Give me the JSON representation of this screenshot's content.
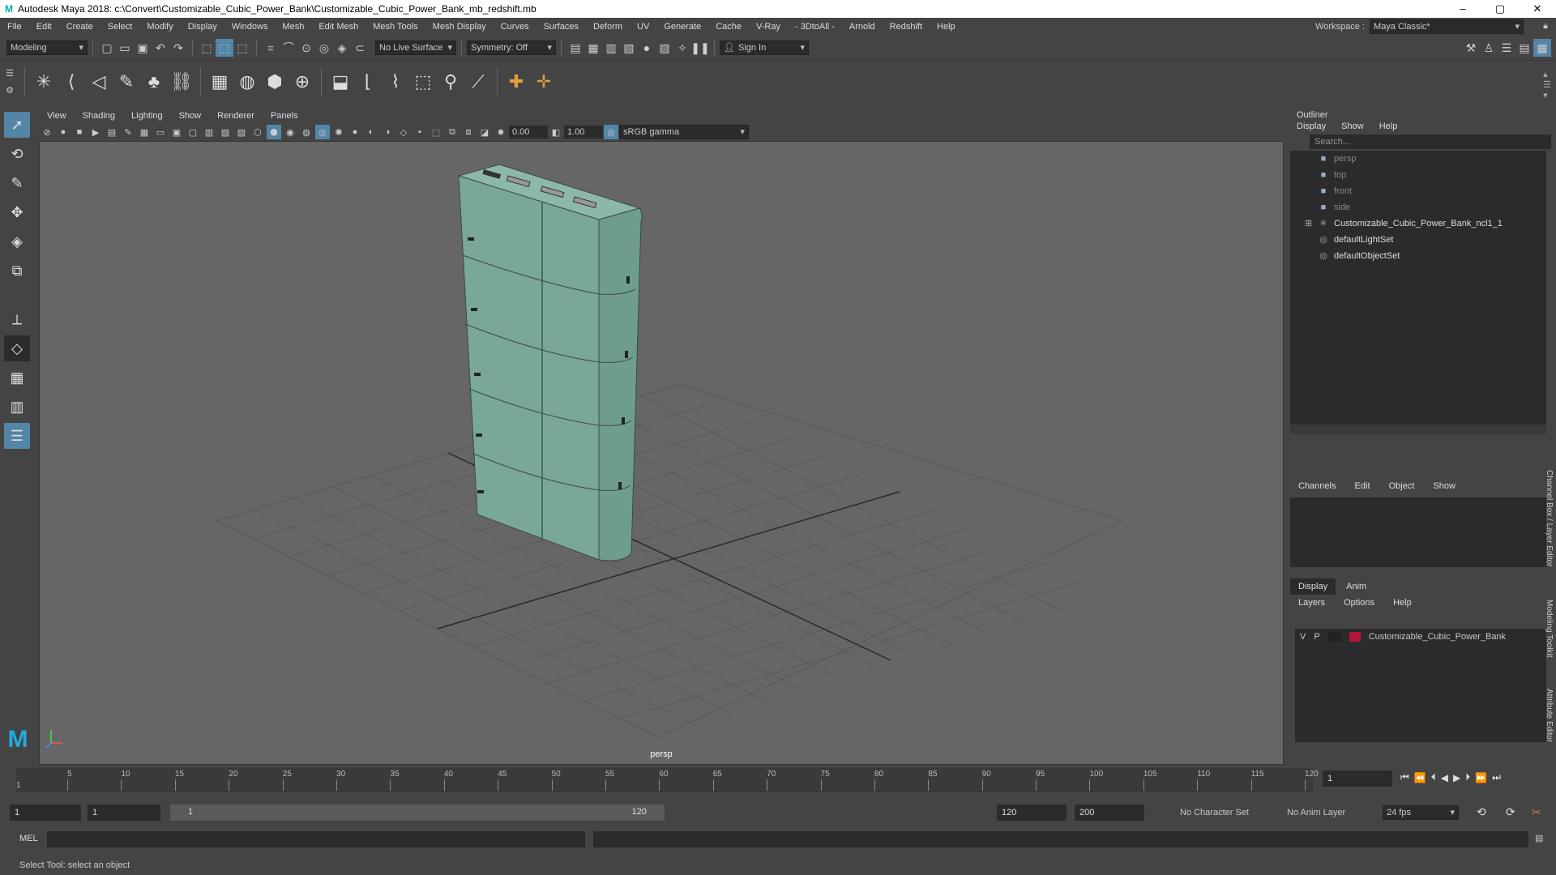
{
  "window": {
    "title": "Autodesk Maya 2018: c:\\Convert\\Customizable_Cubic_Power_Bank\\Customizable_Cubic_Power_Bank_mb_redshift.mb",
    "min": "–",
    "max": "▢",
    "close": "✕"
  },
  "menubar": {
    "items": [
      "File",
      "Edit",
      "Create",
      "Select",
      "Modify",
      "Display",
      "Windows",
      "Mesh",
      "Edit Mesh",
      "Mesh Tools",
      "Mesh Display",
      "Curves",
      "Surfaces",
      "Deform",
      "UV",
      "Generate",
      "Cache",
      "V-Ray",
      "- 3DtoAll -",
      "Arnold",
      "Redshift",
      "Help"
    ],
    "workspace_label": "Workspace :",
    "workspace_value": "Maya Classic*"
  },
  "statusline": {
    "mode": "Modeling",
    "live_surface": "No Live Surface",
    "symmetry": "Symmetry: Off",
    "sign_in": "Sign In"
  },
  "viewport": {
    "menu": [
      "View",
      "Shading",
      "Lighting",
      "Show",
      "Renderer",
      "Panels"
    ],
    "exposure": "0.00",
    "gamma": "1.00",
    "colorspace": "sRGB gamma",
    "camera_label": "persp",
    "model_color": "#79a898"
  },
  "outliner": {
    "title": "Outliner",
    "menu": [
      "Display",
      "Show",
      "Help"
    ],
    "search_placeholder": "Search...",
    "items": [
      {
        "label": "persp",
        "icon": "camera-icon",
        "dim": true
      },
      {
        "label": "top",
        "icon": "camera-icon",
        "dim": true
      },
      {
        "label": "front",
        "icon": "camera-icon",
        "dim": true
      },
      {
        "label": "side",
        "icon": "camera-icon",
        "dim": true
      },
      {
        "label": "Customizable_Cubic_Power_Bank_ncl1_1",
        "icon": "group-icon",
        "dim": false
      },
      {
        "label": "defaultLightSet",
        "icon": "set-icon",
        "dim": false
      },
      {
        "label": "defaultObjectSet",
        "icon": "set-icon",
        "dim": false
      }
    ]
  },
  "channelbox": {
    "menu": [
      "Channels",
      "Edit",
      "Object",
      "Show"
    ]
  },
  "layers": {
    "tabs": [
      "Display",
      "Anim"
    ],
    "menu": [
      "Layers",
      "Options",
      "Help"
    ],
    "row": {
      "v": "V",
      "p": "P",
      "name": "Customizable_Cubic_Power_Bank",
      "color": "#b0173a"
    }
  },
  "side_tabs": [
    "Channel Box / Layer Editor",
    "Modeling Toolkit",
    "Attribute Editor"
  ],
  "timeslider": {
    "ticks": [
      "5",
      "10",
      "15",
      "20",
      "25",
      "30",
      "35",
      "40",
      "45",
      "50",
      "55",
      "60",
      "65",
      "70",
      "75",
      "80",
      "85",
      "90",
      "95",
      "100",
      "105",
      "110",
      "115",
      "120"
    ],
    "start_marker": "1",
    "current_frame": "1"
  },
  "range": {
    "start": "1",
    "playback_start": "1",
    "slider_start": "1",
    "slider_end": "120",
    "playback_end": "120",
    "end": "200",
    "character_set": "No Character Set",
    "anim_layer": "No Anim Layer",
    "fps": "24 fps"
  },
  "cmdline": {
    "label": "MEL"
  },
  "helpline": {
    "text": "Select Tool: select an object"
  }
}
